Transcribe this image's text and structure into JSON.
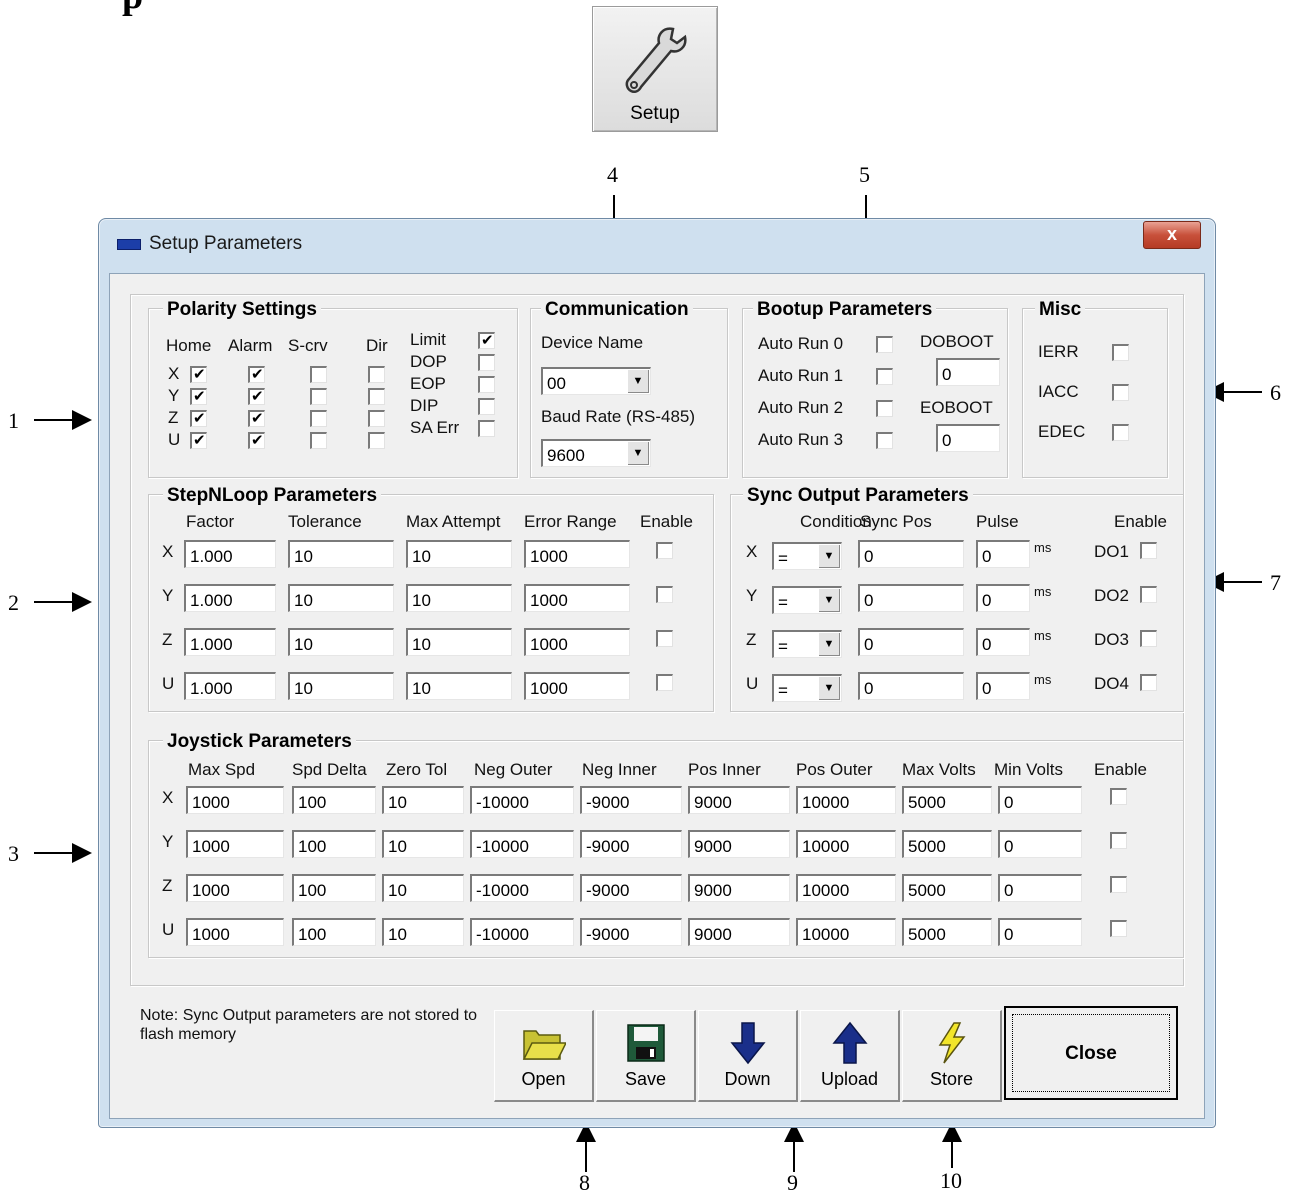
{
  "setup_button": {
    "label": "Setup",
    "icon": "wrench-icon"
  },
  "callouts": [
    "1",
    "2",
    "3",
    "4",
    "5",
    "6",
    "7",
    "8",
    "9",
    "10"
  ],
  "window": {
    "title": "Setup Parameters",
    "close_glyph": "x"
  },
  "polarity": {
    "title": "Polarity Settings",
    "headers": [
      "Home",
      "Alarm",
      "S-crv",
      "Dir"
    ],
    "axes": [
      "X",
      "Y",
      "Z",
      "U"
    ],
    "checks": [
      [
        true,
        true,
        false,
        false
      ],
      [
        true,
        true,
        false,
        false
      ],
      [
        true,
        true,
        false,
        false
      ],
      [
        true,
        true,
        false,
        false
      ]
    ],
    "right_labels": [
      "Limit",
      "DOP",
      "EOP",
      "DIP",
      "SA Err"
    ],
    "right_checks": [
      true,
      false,
      false,
      false,
      false
    ]
  },
  "communication": {
    "title": "Communication",
    "device_label": "Device Name",
    "device_value": "00",
    "baud_label": "Baud Rate (RS-485)",
    "baud_value": "9600"
  },
  "bootup": {
    "title": "Bootup Parameters",
    "autorun_labels": [
      "Auto Run 0",
      "Auto Run 1",
      "Auto Run 2",
      "Auto Run 3"
    ],
    "autorun_checks": [
      false,
      false,
      false,
      false
    ],
    "doboot_label": "DOBOOT",
    "doboot_value": "0",
    "eoboot_label": "EOBOOT",
    "eoboot_value": "0"
  },
  "misc": {
    "title": "Misc",
    "labels": [
      "IERR",
      "IACC",
      "EDEC"
    ],
    "checks": [
      false,
      false,
      false
    ]
  },
  "stepnloop": {
    "title": "StepNLoop Parameters",
    "headers": [
      "Factor",
      "Tolerance",
      "Max Attempt",
      "Error Range",
      "Enable"
    ],
    "axes": [
      "X",
      "Y",
      "Z",
      "U"
    ],
    "rows": [
      [
        "1.000",
        "10",
        "10",
        "1000"
      ],
      [
        "1.000",
        "10",
        "10",
        "1000"
      ],
      [
        "1.000",
        "10",
        "10",
        "1000"
      ],
      [
        "1.000",
        "10",
        "10",
        "1000"
      ]
    ],
    "enable": [
      false,
      false,
      false,
      false
    ]
  },
  "sync": {
    "title": "Sync Output Parameters",
    "headers": [
      "Condition",
      "Sync Pos",
      "Pulse",
      "Enable"
    ],
    "axes": [
      "X",
      "Y",
      "Z",
      "U"
    ],
    "conditions": [
      "=",
      "=",
      "=",
      "="
    ],
    "sync_pos": [
      "0",
      "0",
      "0",
      "0"
    ],
    "pulse": [
      "0",
      "0",
      "0",
      "0"
    ],
    "unit": "ms",
    "outputs": [
      "DO1",
      "DO2",
      "DO3",
      "DO4"
    ],
    "enable": [
      false,
      false,
      false,
      false
    ]
  },
  "joystick": {
    "title": "Joystick Parameters",
    "headers": [
      "Max Spd",
      "Spd Delta",
      "Zero Tol",
      "Neg Outer",
      "Neg Inner",
      "Pos Inner",
      "Pos Outer",
      "Max Volts",
      "Min Volts",
      "Enable"
    ],
    "axes": [
      "X",
      "Y",
      "Z",
      "U"
    ],
    "rows": [
      [
        "1000",
        "100",
        "10",
        "-10000",
        "-9000",
        "9000",
        "10000",
        "5000",
        "0"
      ],
      [
        "1000",
        "100",
        "10",
        "-10000",
        "-9000",
        "9000",
        "10000",
        "5000",
        "0"
      ],
      [
        "1000",
        "100",
        "10",
        "-10000",
        "-9000",
        "9000",
        "10000",
        "5000",
        "0"
      ],
      [
        "1000",
        "100",
        "10",
        "-10000",
        "-9000",
        "9000",
        "10000",
        "5000",
        "0"
      ]
    ],
    "enable": [
      false,
      false,
      false,
      false
    ]
  },
  "footer": {
    "note": "Note: Sync Output parameters are not stored to flash memory",
    "buttons": [
      {
        "label": "Open",
        "icon": "folder-open-icon"
      },
      {
        "label": "Save",
        "icon": "floppy-disk-icon"
      },
      {
        "label": "Down",
        "icon": "arrow-down-icon"
      },
      {
        "label": "Upload",
        "icon": "arrow-up-icon"
      },
      {
        "label": "Store",
        "icon": "lightning-icon"
      }
    ],
    "close_label": "Close"
  },
  "colors": {
    "window_frame": "#cfe0ef",
    "client": "#f0f0f0",
    "close_red": "#c8513b",
    "arrow_blue": "#1a2f8a",
    "folder_yellow": "#e8e04a"
  }
}
